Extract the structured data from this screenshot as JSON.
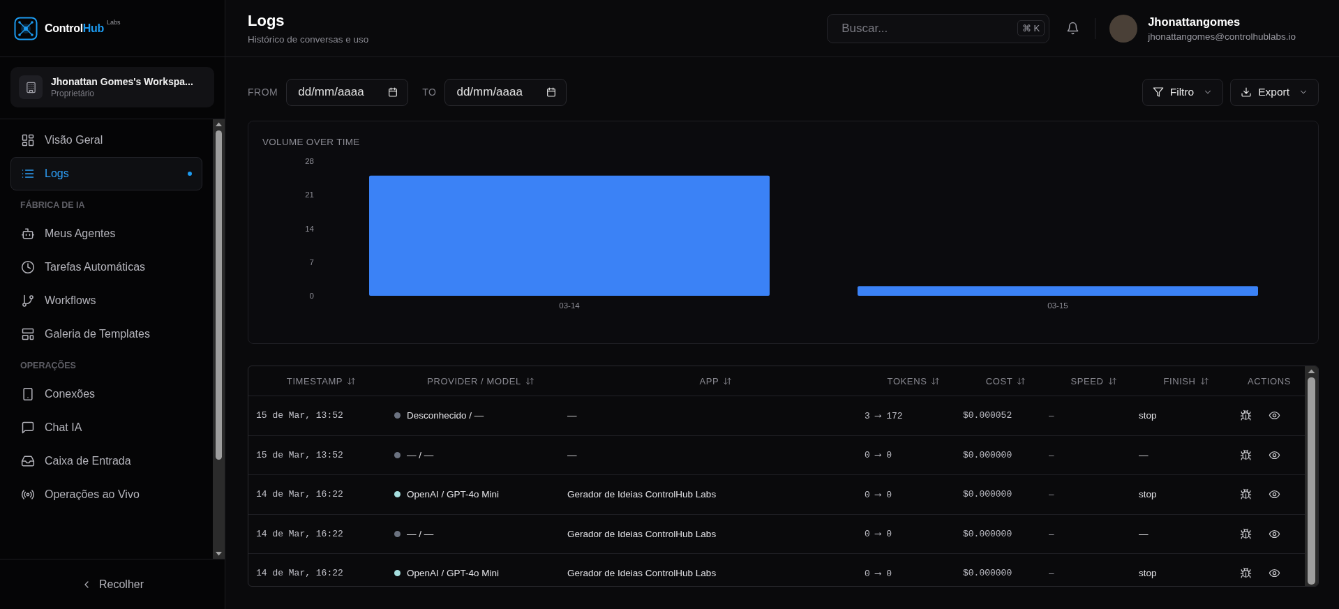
{
  "sidebar": {
    "logo": {
      "text": "Control",
      "accent": "Hub",
      "suffix": "Labs"
    },
    "workspace": {
      "name": "Jhonattan Gomes's Workspa...",
      "role": "Proprietário"
    },
    "sections": [
      {
        "items": [
          {
            "label": "Visão Geral",
            "selected": false
          },
          {
            "label": "Logs",
            "selected": true
          }
        ]
      },
      {
        "heading": "FÁBRICA DE IA",
        "items": [
          {
            "label": "Meus Agentes",
            "selected": false
          },
          {
            "label": "Tarefas Automáticas",
            "selected": false
          },
          {
            "label": "Workflows",
            "selected": false
          },
          {
            "label": "Galeria de Templates",
            "selected": false
          }
        ]
      },
      {
        "heading": "OPERAÇÕES",
        "items": [
          {
            "label": "Conexões",
            "selected": false
          },
          {
            "label": "Chat IA",
            "selected": false
          },
          {
            "label": "Caixa de Entrada",
            "selected": false
          },
          {
            "label": "Operações ao Vivo",
            "selected": false
          }
        ]
      }
    ],
    "collapse_button": "Recolher"
  },
  "header": {
    "title": "Logs",
    "subtitle": "Histórico de conversas e uso",
    "search": {
      "placeholder": "Buscar...",
      "shortcut": "⌘ K"
    },
    "user": {
      "name": "Jhonattangomes",
      "email": "jhonattangomes@controlhublabs.io"
    }
  },
  "filters": {
    "from": {
      "label": "FROM",
      "placeholder": "dd/mm/aaaa"
    },
    "to": {
      "label": "TO",
      "placeholder": "dd/mm/aaaa"
    },
    "buttons": [
      {
        "label": "Filtro",
        "kind": "filter"
      },
      {
        "label": "Export",
        "kind": "export"
      }
    ]
  },
  "chart": {
    "chart_data": {
      "type": "bar",
      "title": "VOLUME OVER TIME",
      "categories": [
        "03-14",
        "03-15"
      ],
      "series": [
        {
          "color": "#3b82f6",
          "values": [
            25,
            2
          ]
        }
      ],
      "ylim": [
        0,
        28
      ],
      "yticks": [
        0,
        7,
        14,
        21,
        28
      ]
    }
  },
  "table": {
    "columns": [
      {
        "label": "TIMESTAMP",
        "sortable": true
      },
      {
        "label": "PROVIDER / MODEL",
        "sortable": true
      },
      {
        "label": "APP",
        "sortable": true
      },
      {
        "label": "TOKENS",
        "sortable": true
      },
      {
        "label": "COST",
        "sortable": true
      },
      {
        "label": "SPEED",
        "sortable": true
      },
      {
        "label": "FINISH",
        "sortable": true
      },
      {
        "label": "ACTIONS",
        "sortable": false
      }
    ],
    "rows": [
      {
        "timestamp": "15 de Mar, 13:52",
        "color": "#6b7280",
        "provider": "Desconhecido / —",
        "app": "—",
        "tokens": "3 ⟶ 172",
        "cost": "$0.000052",
        "speed": "–",
        "finish": "stop"
      },
      {
        "timestamp": "15 de Mar, 13:52",
        "color": "#6b7280",
        "provider": "— / —",
        "app": "—",
        "tokens": "0 ⟶ 0",
        "cost": "$0.000000",
        "speed": "–",
        "finish": "—"
      },
      {
        "timestamp": "14 de Mar, 16:22",
        "color": "#a5dede",
        "provider": "OpenAI / GPT-4o Mini",
        "app": "Gerador de Ideias ControlHub Labs",
        "tokens": "0 ⟶ 0",
        "cost": "$0.000000",
        "speed": "–",
        "finish": "stop"
      },
      {
        "timestamp": "14 de Mar, 16:22",
        "color": "#6b7280",
        "provider": "— / —",
        "app": "Gerador de Ideias ControlHub Labs",
        "tokens": "0 ⟶ 0",
        "cost": "$0.000000",
        "speed": "–",
        "finish": "—"
      },
      {
        "timestamp": "14 de Mar, 16:22",
        "color": "#a5dede",
        "provider": "OpenAI / GPT-4o Mini",
        "app": "Gerador de Ideias ControlHub Labs",
        "tokens": "0 ⟶ 0",
        "cost": "$0.000000",
        "speed": "–",
        "finish": "stop"
      }
    ]
  }
}
